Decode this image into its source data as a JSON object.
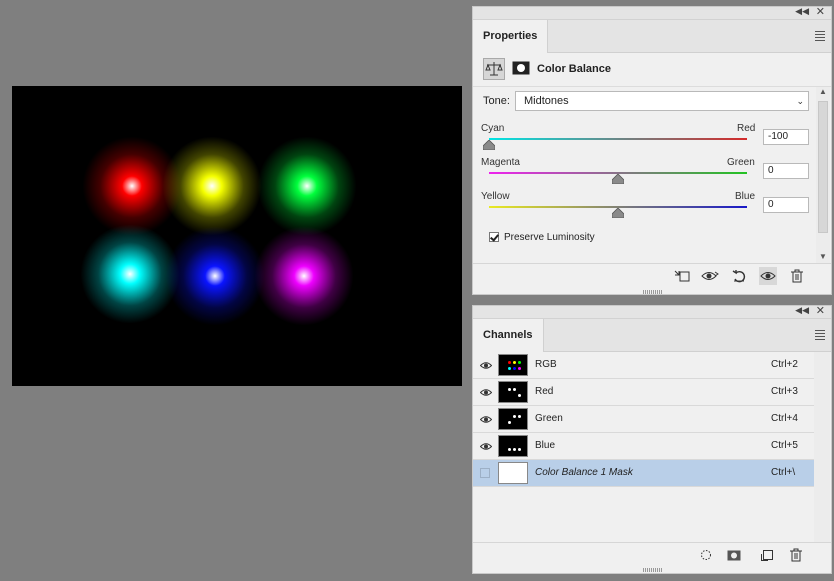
{
  "canvas": {
    "lights": [
      {
        "name": "red-light",
        "color": "#ff0000"
      },
      {
        "name": "yellow-light",
        "color": "#f5ff00"
      },
      {
        "name": "green-light",
        "color": "#00ff3c"
      },
      {
        "name": "cyan-light",
        "color": "#00ffff"
      },
      {
        "name": "blue-light",
        "color": "#0a14ff"
      },
      {
        "name": "magenta-light",
        "color": "#ee00ff"
      }
    ]
  },
  "properties": {
    "tab_label": "Properties",
    "adjustment_title": "Color Balance",
    "tone_label": "Tone:",
    "tone_value": "Midtones",
    "sliders": [
      {
        "left": "Cyan",
        "right": "Red",
        "value": "-100",
        "left_color": "#00e5e5",
        "right_color": "#d42a2a",
        "level": -100
      },
      {
        "left": "Magenta",
        "right": "Green",
        "value": "0",
        "left_color": "#ee22ee",
        "right_color": "#22c322",
        "level": 0
      },
      {
        "left": "Yellow",
        "right": "Blue",
        "value": "0",
        "left_color": "#eaea22",
        "right_color": "#1818c8",
        "level": 0
      }
    ],
    "preserve_luminosity_label": "Preserve Luminosity",
    "preserve_luminosity": true
  },
  "channels": {
    "tab_label": "Channels",
    "rows": [
      {
        "name": "RGB",
        "shortcut": "Ctrl+2",
        "visible": true,
        "italic": false
      },
      {
        "name": "Red",
        "shortcut": "Ctrl+3",
        "visible": true,
        "italic": false
      },
      {
        "name": "Green",
        "shortcut": "Ctrl+4",
        "visible": true,
        "italic": false
      },
      {
        "name": "Blue",
        "shortcut": "Ctrl+5",
        "visible": true,
        "italic": false
      },
      {
        "name": "Color Balance 1 Mask",
        "shortcut": "Ctrl+\\",
        "visible": false,
        "italic": true,
        "selected": true
      }
    ]
  },
  "icons": {
    "properties_bottom": [
      "clip-to-layer-icon",
      "view-previous-state-icon",
      "reset-icon",
      "toggle-visibility-icon",
      "delete-icon"
    ],
    "channels_bottom": [
      "load-selection-icon",
      "save-selection-icon",
      "new-channel-icon",
      "delete-icon"
    ]
  }
}
